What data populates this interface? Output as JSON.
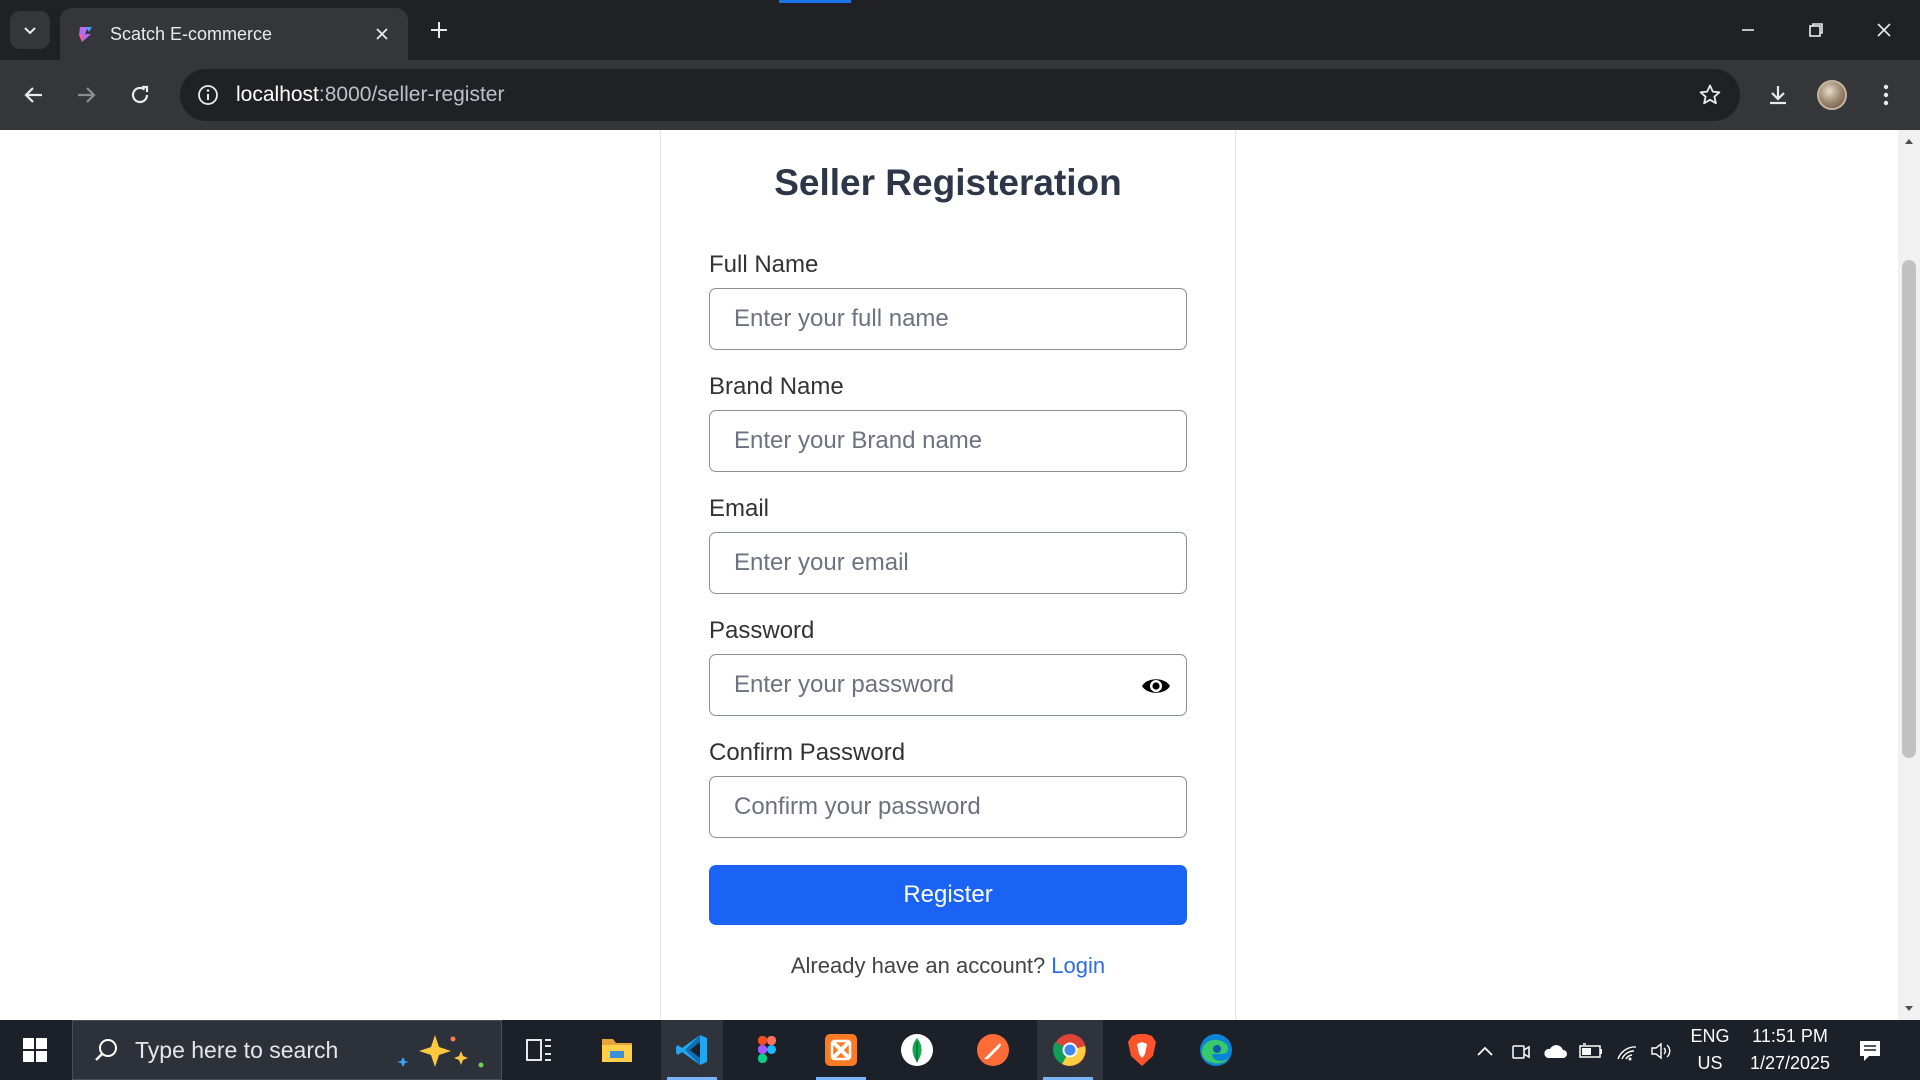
{
  "browser": {
    "tab_title": "Scatch E-commerce",
    "url_host": "localhost",
    "url_path": ":8000/seller-register"
  },
  "form": {
    "title": "Seller Registeration",
    "fields": [
      {
        "label": "Full Name",
        "placeholder": "Enter your full name",
        "type": "text"
      },
      {
        "label": "Brand Name",
        "placeholder": "Enter your Brand name",
        "type": "text"
      },
      {
        "label": "Email",
        "placeholder": "Enter your email",
        "type": "email"
      },
      {
        "label": "Password",
        "placeholder": "Enter your password",
        "type": "password"
      },
      {
        "label": "Confirm Password",
        "placeholder": "Confirm your password",
        "type": "password"
      }
    ],
    "submit_label": "Register",
    "login_prompt": "Already have an account?",
    "login_link": "Login"
  },
  "taskbar": {
    "search_placeholder": "Type here to search",
    "language_line1": "ENG",
    "language_line2": "US",
    "time": "11:51 PM",
    "date": "1/27/2025"
  },
  "colors": {
    "primary_button": "#1a63f5",
    "link": "#2b6de8",
    "chrome_dark": "#202124",
    "chrome_toolbar": "#35363a"
  },
  "icons": {
    "password_toggle": "eye-icon",
    "taskbar_apps": [
      "task-view-icon",
      "file-explorer-icon",
      "vscode-icon",
      "figma-icon",
      "xampp-icon",
      "mongodb-compass-icon",
      "postman-icon",
      "chrome-icon",
      "brave-icon",
      "edge-icon"
    ]
  }
}
